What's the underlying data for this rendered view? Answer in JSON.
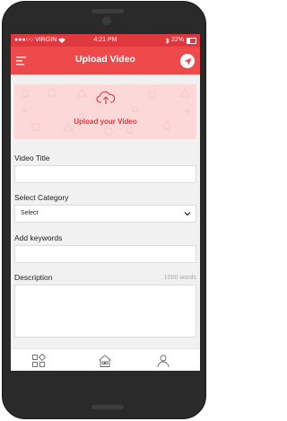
{
  "status_bar": {
    "carrier": "VIRGIN",
    "time": "4:21 PM",
    "battery": "22%"
  },
  "app_bar": {
    "title": "Upload Video",
    "menu_icon": "hamburger-menu-icon",
    "action_icon": "send-icon"
  },
  "upload": {
    "label": "Upload your Video",
    "icon": "cloud-upload-icon"
  },
  "form": {
    "video_title_label": "Video Title",
    "video_title_value": "",
    "category_label": "Select Category",
    "category_selected": "Select",
    "keywords_label": "Add keywords",
    "keywords_value": "",
    "description_label": "Description",
    "description_limit": "1000 words",
    "description_value": ""
  },
  "bottom_nav": {
    "items": [
      {
        "icon": "grid-shapes-icon"
      },
      {
        "icon": "home-icon"
      },
      {
        "icon": "user-icon"
      }
    ]
  },
  "colors": {
    "accent": "#ef4a4b",
    "status_bar": "#e0383e",
    "upload_bg": "#fcd8d8"
  }
}
